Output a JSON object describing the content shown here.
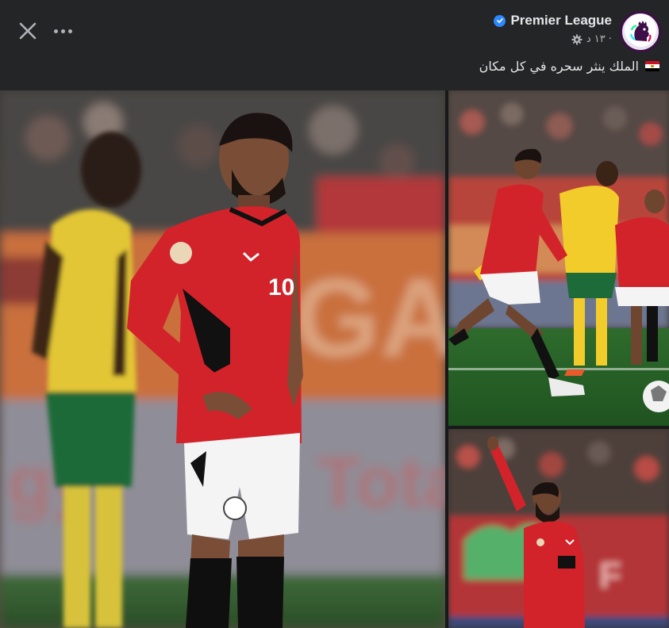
{
  "header": {
    "page_name": "Premier League",
    "time_label": "١٣ د ·",
    "caption": "الملك ينثر سحره في كل مكان",
    "close_icon": "close-icon",
    "more_icon": "more-options-icon",
    "verified_icon": "verified-badge-icon",
    "privacy_icon": "gear-icon",
    "caption_emoji": "egypt-flag-icon"
  },
  "photos": {
    "main": {
      "jersey_number": "10"
    },
    "top_right": {},
    "bottom_right": {}
  },
  "colors": {
    "background": "#18191a",
    "header_bg": "#242526",
    "accent_blue": "#2d88ff",
    "egypt_red": "#d2232a",
    "south_africa_yellow": "#f2cc2b",
    "south_africa_green": "#1e6b3a"
  }
}
